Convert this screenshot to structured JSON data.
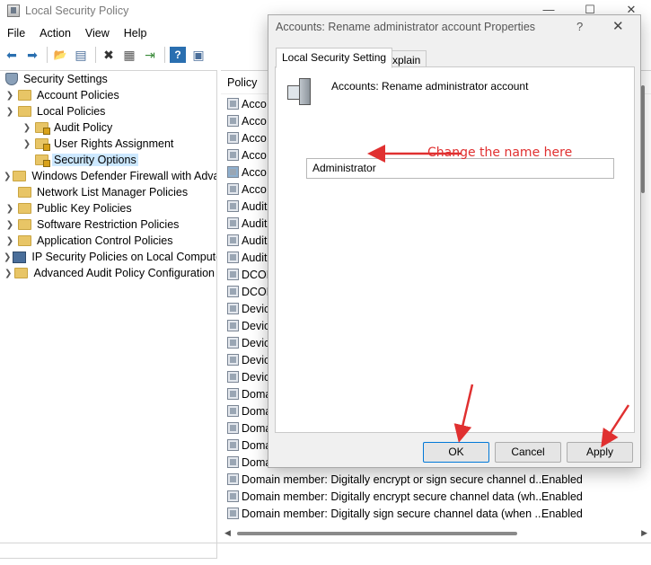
{
  "window": {
    "title": "Local Security Policy",
    "minimize_glyph": "—",
    "maximize_glyph": "☐",
    "close_glyph": "✕"
  },
  "menu": [
    "File",
    "Action",
    "View",
    "Help"
  ],
  "toolbar": {
    "icons": [
      "back-icon",
      "forward-icon",
      "up-folder-icon",
      "show-hide-tree-icon",
      "delete-icon",
      "properties-icon",
      "export-list-icon",
      "help-icon",
      "show-console-icon"
    ],
    "glyphs": [
      "⬅",
      "➡",
      "📂",
      "▤",
      "✖",
      "▦",
      "⇥",
      "?",
      "▣"
    ]
  },
  "tree": {
    "root_label": "Security Settings",
    "items": [
      {
        "label": "Account Policies",
        "expanded": false,
        "level": 1,
        "icon": "folder"
      },
      {
        "label": "Local Policies",
        "expanded": true,
        "level": 1,
        "icon": "folder"
      },
      {
        "label": "Audit Policy",
        "expanded": false,
        "level": 2,
        "icon": "folder-lock"
      },
      {
        "label": "User Rights Assignment",
        "expanded": false,
        "level": 2,
        "icon": "folder-lock"
      },
      {
        "label": "Security Options",
        "expanded": null,
        "level": 2,
        "icon": "folder-lock",
        "selected": true
      },
      {
        "label": "Windows Defender Firewall with Adva",
        "expanded": false,
        "level": 1,
        "icon": "folder"
      },
      {
        "label": "Network List Manager Policies",
        "expanded": null,
        "level": 1,
        "icon": "folder"
      },
      {
        "label": "Public Key Policies",
        "expanded": false,
        "level": 1,
        "icon": "folder"
      },
      {
        "label": "Software Restriction Policies",
        "expanded": false,
        "level": 1,
        "icon": "folder"
      },
      {
        "label": "Application Control Policies",
        "expanded": false,
        "level": 1,
        "icon": "folder"
      },
      {
        "label": "IP Security Policies on Local Compute",
        "expanded": false,
        "level": 1,
        "icon": "network"
      },
      {
        "label": "Advanced Audit Policy Configuration",
        "expanded": false,
        "level": 1,
        "icon": "folder"
      }
    ]
  },
  "list": {
    "header": "Policy",
    "rows": [
      {
        "policy": "Acco",
        "setting": ""
      },
      {
        "policy": "Acco",
        "setting": ""
      },
      {
        "policy": "Acco",
        "setting": ""
      },
      {
        "policy": "Acco",
        "setting": ""
      },
      {
        "policy": "Acco",
        "setting": "",
        "selected": true
      },
      {
        "policy": "Acco",
        "setting": ""
      },
      {
        "policy": "Audit",
        "setting": ""
      },
      {
        "policy": "Audit",
        "setting": ""
      },
      {
        "policy": "Audit",
        "setting": ""
      },
      {
        "policy": "Audit",
        "setting": ""
      },
      {
        "policy": "DCOM",
        "setting": ""
      },
      {
        "policy": "DCOM",
        "setting": ""
      },
      {
        "policy": "Devic",
        "setting": ""
      },
      {
        "policy": "Devic",
        "setting": ""
      },
      {
        "policy": "Devic",
        "setting": ""
      },
      {
        "policy": "Devic",
        "setting": ""
      },
      {
        "policy": "Devic",
        "setting": ""
      },
      {
        "policy": "Doma",
        "setting": ""
      },
      {
        "policy": "Doma",
        "setting": ""
      },
      {
        "policy": "Doma",
        "setting": ""
      },
      {
        "policy": "Doma",
        "setting": ""
      },
      {
        "policy": "Doma",
        "setting": ""
      },
      {
        "policy": "Domain member: Digitally encrypt or sign secure channel d...",
        "setting": "Enabled"
      },
      {
        "policy": "Domain member: Digitally encrypt secure channel data (wh...",
        "setting": "Enabled"
      },
      {
        "policy": "Domain member: Digitally sign secure channel data (when ...",
        "setting": "Enabled"
      }
    ]
  },
  "dialog": {
    "title": "Accounts: Rename administrator account Properties",
    "help_glyph": "?",
    "close_glyph": "✕",
    "tabs": [
      "Local Security Setting",
      "Explain"
    ],
    "policy_name": "Accounts: Rename administrator account",
    "field_value": "Administrator",
    "annotation": "Change the name here",
    "buttons": {
      "ok": "OK",
      "cancel": "Cancel",
      "apply": "Apply"
    }
  },
  "colors": {
    "annotation": "#e03030",
    "selection": "#cce8ff",
    "folder": "#e8c566"
  }
}
